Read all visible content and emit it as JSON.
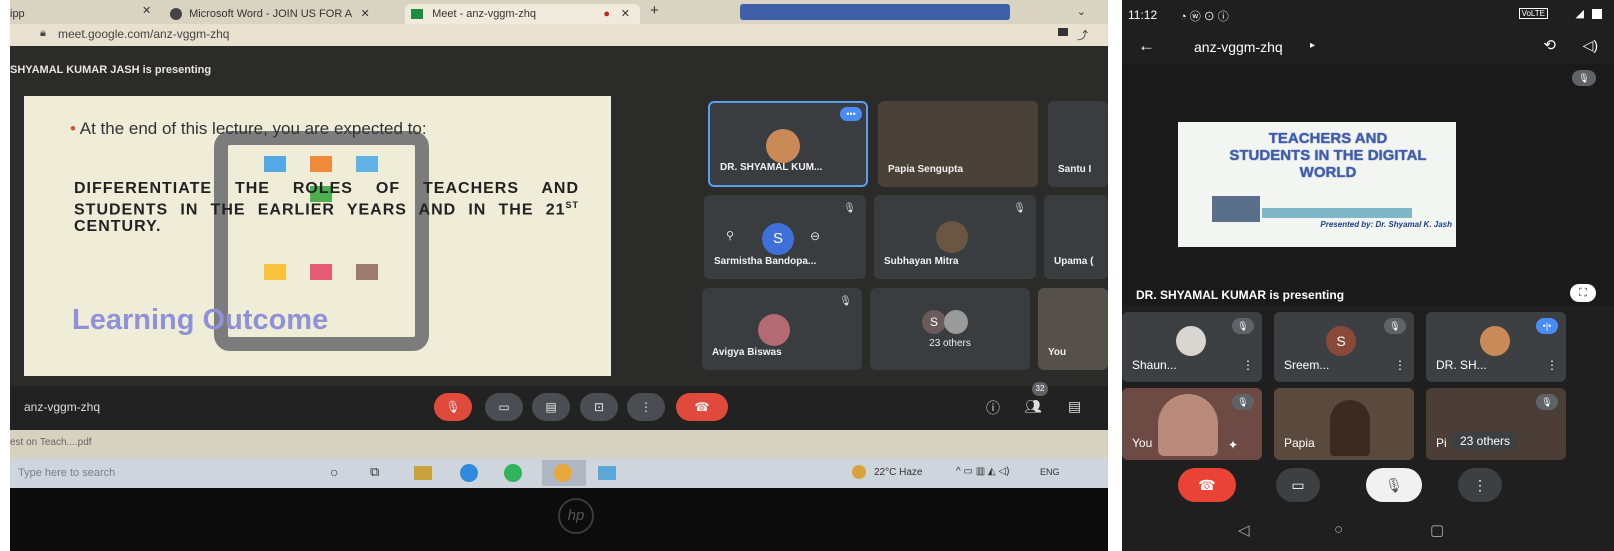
{
  "browser": {
    "tabs": [
      "ipp",
      "Microsoft Word - JOIN US FOR A",
      "Meet - anz-vggm-zhq"
    ],
    "url": "meet.google.com/anz-vggm-zhq"
  },
  "meet_desktop": {
    "presenting_banner": "SHYAMAL KUMAR JASH is presenting",
    "slide": {
      "bullet": "At the end of this lecture, you are expected to:",
      "body": "DIFFERENTIATE THE ROLES OF TEACHERS AND STUDENTS IN THE EARLIER YEARS AND IN THE 21",
      "superscript": "ST",
      "body_end": "CENTURY.",
      "title": "Learning Outcome"
    },
    "tiles": [
      {
        "name": "DR. SHYAMAL KUM...",
        "muted": false
      },
      {
        "name": "Papia Sengupta",
        "muted": false
      },
      {
        "name": "Santu I",
        "muted": false
      },
      {
        "name": "Sarmistha Bandopa...",
        "muted": true,
        "initial": "S"
      },
      {
        "name": "Subhayan Mitra",
        "muted": true
      },
      {
        "name": "Upama (",
        "muted": false
      },
      {
        "name": "Avigya Biswas",
        "muted": true
      },
      {
        "name": "23 others",
        "muted": false,
        "initial": "S"
      },
      {
        "name": "You",
        "muted": false
      }
    ],
    "meeting_code": "anz-vggm-zhq",
    "participant_count": "32"
  },
  "download_bar": {
    "file": "est on Teach....pdf"
  },
  "taskbar": {
    "search_placeholder": "Type here to search",
    "weather": "22°C Haze",
    "lang": "ENG"
  },
  "phone": {
    "status": {
      "time": "11:12",
      "network": "VoLTE"
    },
    "meeting_code": "anz-vggm-zhq",
    "slide": {
      "title": "TEACHERS AND STUDENTS IN THE DIGITAL WORLD",
      "presenter": "Presented by: Dr. Shyamal K. Jash"
    },
    "presenting_banner": "DR. SHYAMAL KUMAR is presenting",
    "tiles": [
      {
        "name": "Shaun..."
      },
      {
        "name": "Sreem...",
        "initial": "S"
      },
      {
        "name": "DR. SH..."
      },
      {
        "name": "You"
      },
      {
        "name": "Papia"
      },
      {
        "name": "23 others",
        "extra": "Pi"
      }
    ]
  },
  "colors": {
    "end_call_red": "#ea4335",
    "meet_tile": "#3c4043",
    "slide_title_blue": "#3d5db0",
    "active_speaker": "#4a8cf7"
  }
}
